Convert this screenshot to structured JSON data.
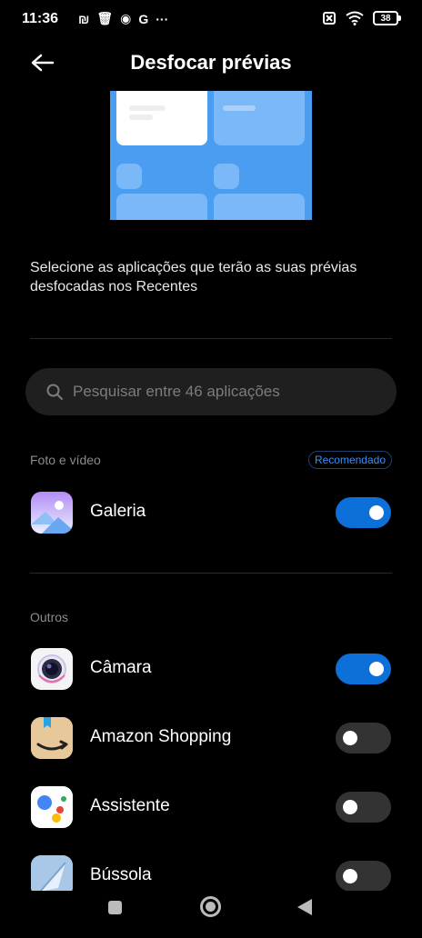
{
  "status_bar": {
    "time": "11:36",
    "left_glyphs": [
      "₪",
      "🗑",
      "◉",
      "G",
      "···"
    ],
    "battery": "38"
  },
  "header": {
    "title": "Desfocar prévias",
    "back_icon": "arrow-left-icon"
  },
  "description": "Selecione as aplicações que terão as suas prévias desfocadas nos Recentes",
  "search": {
    "placeholder": "Pesquisar entre 46 aplicações"
  },
  "sections": {
    "photo": {
      "label": "Foto e vídeo",
      "badge": "Recomendado"
    },
    "others": {
      "label": "Outros"
    }
  },
  "apps": {
    "galeria": {
      "name": "Galeria",
      "enabled": true
    },
    "camara": {
      "name": "Câmara",
      "enabled": true
    },
    "amazon": {
      "name": "Amazon Shopping",
      "enabled": false
    },
    "assistente": {
      "name": "Assistente",
      "enabled": false
    },
    "bussola": {
      "name": "Bússola",
      "enabled": false
    }
  },
  "colors": {
    "accent": "#0d6fd8",
    "toggle_off": "#333333",
    "background": "#000000",
    "search_bg": "#1f1f1f",
    "badge_text": "#3e8ef7",
    "preview_blue": "#4a9df0"
  }
}
